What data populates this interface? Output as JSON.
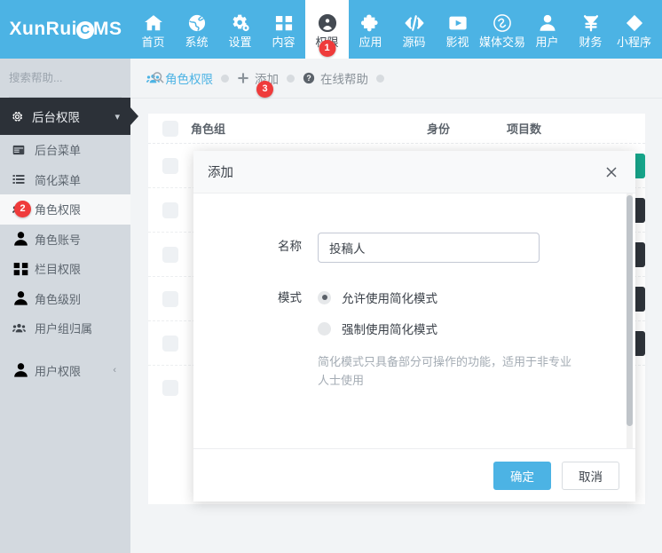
{
  "brand": {
    "text_left": "XunRui",
    "flame": "C",
    "text_right": "MS"
  },
  "topnav": {
    "items": [
      {
        "label": "首页",
        "icon": "home-icon",
        "active": false,
        "badge": ""
      },
      {
        "label": "系统",
        "icon": "globe-icon",
        "active": false,
        "badge": ""
      },
      {
        "label": "设置",
        "icon": "gears-icon",
        "active": false,
        "badge": ""
      },
      {
        "label": "内容",
        "icon": "grid-icon",
        "active": false,
        "badge": ""
      },
      {
        "label": "权限",
        "icon": "user-circle-icon",
        "active": true,
        "badge": "1"
      },
      {
        "label": "应用",
        "icon": "puzzle-icon",
        "active": false,
        "badge": ""
      },
      {
        "label": "源码",
        "icon": "code-icon",
        "active": false,
        "badge": ""
      },
      {
        "label": "影视",
        "icon": "video-icon",
        "active": false,
        "badge": ""
      },
      {
        "label": "媒体交易",
        "icon": "media-exchange-icon",
        "active": false,
        "badge": ""
      },
      {
        "label": "用户",
        "icon": "user-icon",
        "active": false,
        "badge": ""
      },
      {
        "label": "财务",
        "icon": "yuan-icon",
        "active": false,
        "badge": ""
      },
      {
        "label": "小程序",
        "icon": "diamond-icon",
        "active": false,
        "badge": ""
      }
    ]
  },
  "sidebar": {
    "search": {
      "value": "",
      "placeholder": "搜索帮助..."
    },
    "group": {
      "label": "后台权限",
      "icon": "gear-icon",
      "caret": "chevron-down-icon"
    },
    "items": [
      {
        "label": "后台菜单",
        "icon": "window-icon",
        "selected": false,
        "badge": "",
        "caret": ""
      },
      {
        "label": "简化菜单",
        "icon": "list-icon",
        "selected": false,
        "badge": "",
        "caret": ""
      },
      {
        "label": "角色权限",
        "icon": "users-icon",
        "selected": true,
        "badge": "2",
        "caret": ""
      },
      {
        "label": "角色账号",
        "icon": "user-icon",
        "selected": false,
        "badge": "",
        "caret": ""
      },
      {
        "label": "栏目权限",
        "icon": "grid-icon",
        "selected": false,
        "badge": "",
        "caret": ""
      },
      {
        "label": "角色级别",
        "icon": "user-icon",
        "selected": false,
        "badge": "",
        "caret": ""
      },
      {
        "label": "用户组归属",
        "icon": "users-icon",
        "selected": false,
        "badge": "",
        "caret": ""
      },
      {
        "label": "用户权限",
        "icon": "user-icon",
        "selected": false,
        "badge": "",
        "caret": "chevron-left-icon"
      }
    ]
  },
  "breadcrumb": {
    "items": [
      {
        "label": "角色权限",
        "icon": "users-icon",
        "style": "c-blue",
        "badge": ""
      },
      {
        "label": "添加",
        "icon": "plus-icon",
        "style": "c-gray",
        "badge": "3"
      },
      {
        "label": "在线帮助",
        "icon": "question-icon",
        "style": "c-gray",
        "badge": ""
      }
    ]
  },
  "table": {
    "headers": {
      "group": "角色组",
      "identity": "身份",
      "projects": "项目数"
    },
    "rows": [
      {
        "group": "",
        "identity": "",
        "projects": "",
        "action_label": "",
        "action_style": "teal",
        "action_icon": "edit-icon"
      },
      {
        "group": "",
        "identity": "",
        "projects": "",
        "action_label": "",
        "action_style": "dark",
        "action_icon": "user-group-icon"
      },
      {
        "group": "",
        "identity": "",
        "projects": "",
        "action_label": "",
        "action_style": "dark",
        "action_icon": "user-group-icon"
      },
      {
        "group": "",
        "identity": "",
        "projects": "",
        "action_label": "",
        "action_style": "dark",
        "action_icon": "user-group-icon"
      },
      {
        "group": "",
        "identity": "",
        "projects": "",
        "action_label": "",
        "action_style": "dark",
        "action_icon": "user-group-icon"
      },
      {
        "group": "",
        "identity": "",
        "projects": "",
        "action_label": "",
        "action_style": "",
        "action_icon": ""
      }
    ]
  },
  "modal": {
    "title": "添加",
    "close_icon": "close-icon",
    "name_label": "名称",
    "name_value": "投稿人",
    "name_placeholder": "",
    "mode_label": "模式",
    "mode_options": [
      {
        "label": "允许使用简化模式",
        "selected": true
      },
      {
        "label": "强制使用简化模式",
        "selected": false
      }
    ],
    "hint": "简化模式只具备部分可操作的功能，适用于非专业人士使用",
    "confirm_label": "确定",
    "cancel_label": "取消"
  },
  "colors": {
    "brand_blue": "#4cb3e4",
    "sidebar_bg": "#d3d9df",
    "sidebar_group_bg": "#2c3138",
    "badge_red": "#ef3b3b",
    "action_teal": "#17a78c",
    "action_dark": "#2e333a"
  }
}
